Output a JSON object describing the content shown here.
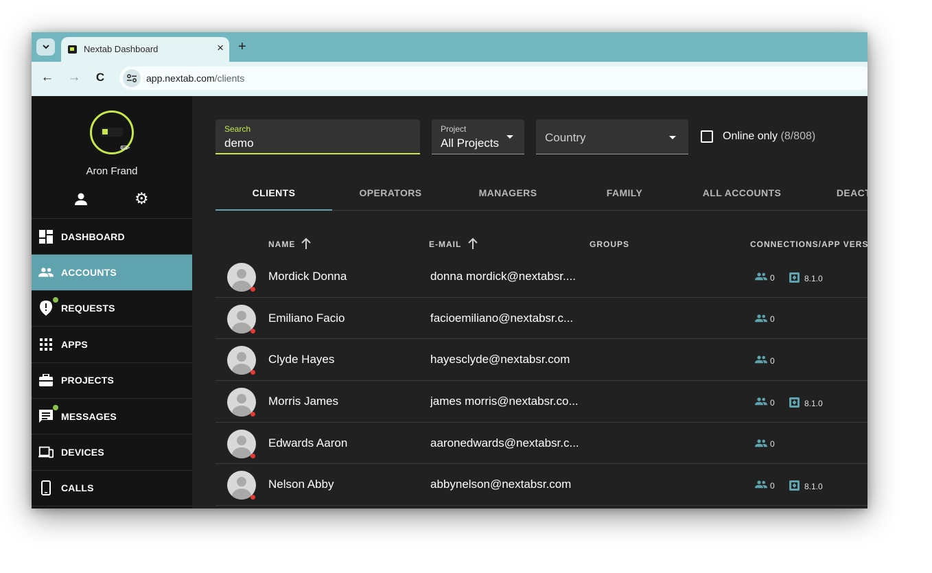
{
  "browser": {
    "tab_title": "Nextab Dashboard",
    "close_glyph": "×",
    "new_tab_glyph": "+",
    "back_glyph": "←",
    "forward_glyph": "→",
    "reload_glyph": "C",
    "url_host": "app.nextab.com",
    "url_path": "/clients"
  },
  "profile": {
    "name": "Aron Frand",
    "edit_glyph": "✎",
    "settings_glyph": "⚙",
    "ring_color": "#c6e84a"
  },
  "sidebar": {
    "active_color": "#5ea3ae",
    "items": [
      {
        "label": "DASHBOARD",
        "icon": "dashboard-icon"
      },
      {
        "label": "ACCOUNTS",
        "icon": "people-icon",
        "active": true
      },
      {
        "label": "REQUESTS",
        "icon": "requests-icon",
        "badge": true
      },
      {
        "label": "APPS",
        "icon": "apps-grid-icon"
      },
      {
        "label": "PROJECTS",
        "icon": "briefcase-icon"
      },
      {
        "label": "MESSAGES",
        "icon": "message-icon",
        "badge": true
      },
      {
        "label": "DEVICES",
        "icon": "devices-icon"
      },
      {
        "label": "CALLS",
        "icon": "phone-icon"
      }
    ]
  },
  "filters": {
    "search_label": "Search",
    "search_value": "demo",
    "project_label": "Project",
    "project_value": "All Projects",
    "country_placeholder": "Country",
    "online_label": "Online only",
    "online_count": "(8/808)"
  },
  "tabs": [
    "CLIENTS",
    "OPERATORS",
    "MANAGERS",
    "FAMILY",
    "ALL ACCOUNTS",
    "DEACTIV"
  ],
  "columns": {
    "name": "NAME",
    "email": "E-MAIL",
    "groups": "GROUPS",
    "connections": "CONNECTIONS/APP VERS"
  },
  "rows": [
    {
      "name": "Mordick Donna",
      "email": "donna mordick@nextabsr....",
      "connections": "0",
      "app_version": "8.1.0"
    },
    {
      "name": "Emiliano Facio",
      "email": "facioemiliano@nextabsr.c...",
      "connections": "0",
      "app_version": ""
    },
    {
      "name": "Clyde Hayes",
      "email": "hayesclyde@nextabsr.com",
      "connections": "0",
      "app_version": ""
    },
    {
      "name": "Morris James",
      "email": "james morris@nextabsr.co...",
      "connections": "0",
      "app_version": "8.1.0"
    },
    {
      "name": "Edwards Aaron",
      "email": "aaronedwards@nextabsr.c...",
      "connections": "0",
      "app_version": ""
    },
    {
      "name": "Nelson Abby",
      "email": "abbynelson@nextabsr.com",
      "connections": "0",
      "app_version": "8.1.0"
    }
  ]
}
